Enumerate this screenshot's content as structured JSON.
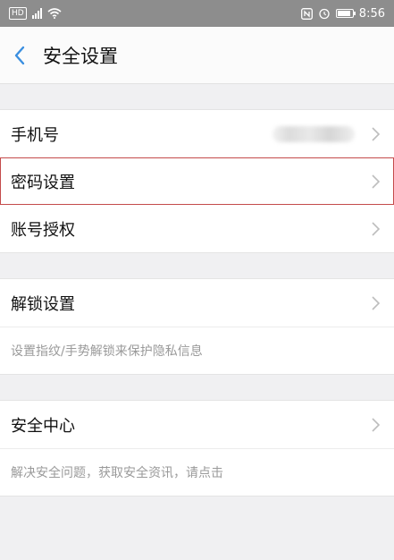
{
  "status_bar": {
    "sim_label": "HD",
    "time": "8:56"
  },
  "header": {
    "title": "安全设置"
  },
  "group1": {
    "rows": [
      {
        "label": "手机号"
      },
      {
        "label": "密码设置"
      },
      {
        "label": "账号授权"
      }
    ]
  },
  "group2": {
    "rows": [
      {
        "label": "解锁设置"
      }
    ],
    "hint": "设置指纹/手势解锁来保护隐私信息"
  },
  "group3": {
    "rows": [
      {
        "label": "安全中心"
      }
    ],
    "hint": "解决安全问题，获取安全资讯，请点击"
  },
  "colors": {
    "accent": "#3b8fe0",
    "highlight_border": "#c44b4b"
  }
}
